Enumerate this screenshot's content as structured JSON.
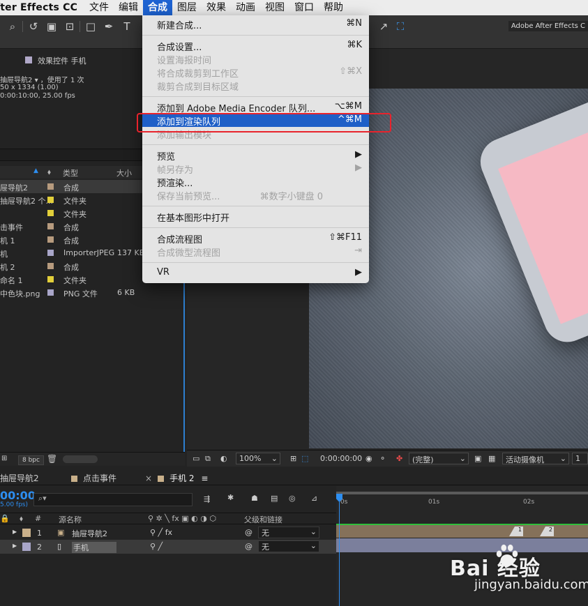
{
  "menubar": {
    "app_name": "fter Effects CC",
    "items": [
      "文件",
      "编辑",
      "合成",
      "图层",
      "效果",
      "动画",
      "视图",
      "窗口",
      "帮助"
    ],
    "active_index": 2
  },
  "toolbar": {
    "app_title": "Adobe After Effects C"
  },
  "effect_controls": {
    "title": "效果控件 手机",
    "comp_name": "抽屉导航2",
    "used": "，使用了 1 次",
    "dims": "50 x 1334 (1.00)",
    "duration": "0:00:10:00, 25.00 fps"
  },
  "project": {
    "col_type": "类型",
    "col_size": "大小",
    "rows": [
      {
        "name": "屉导航2",
        "label_color": "#b79b7e",
        "type": "合成",
        "size": "",
        "selected": true
      },
      {
        "name": "抽屉导航2 个...",
        "label_color": "#e2cf3a",
        "type": "文件夹",
        "size": ""
      },
      {
        "name": "",
        "label_color": "#e2cf3a",
        "type": "文件夹",
        "size": ""
      },
      {
        "name": "击事件",
        "label_color": "#b79b7e",
        "type": "合成",
        "size": ""
      },
      {
        "name": "机 1",
        "label_color": "#b79b7e",
        "type": "合成",
        "size": ""
      },
      {
        "name": "机",
        "label_color": "#a9a6c9",
        "type": "ImporterJPEG",
        "size": "137 KB"
      },
      {
        "name": "机 2",
        "label_color": "#b79b7e",
        "type": "合成",
        "size": ""
      },
      {
        "name": "命名 1",
        "label_color": "#e2cf3a",
        "type": "文件夹",
        "size": ""
      },
      {
        "name": "中色块.png",
        "label_color": "#a9a6c9",
        "type": "PNG 文件",
        "size": "6 KB"
      }
    ],
    "bpc": "8 bpc"
  },
  "viewer": {
    "zoom": "100%",
    "timecode": "0:00:00:00",
    "quality": "(完整)",
    "camera": "活动摄像机",
    "views": "1"
  },
  "timeline": {
    "tabs": [
      {
        "label": "抽屉导航2",
        "color": "#c9b08a"
      },
      {
        "label": "点击事件",
        "color": "#c9b08a"
      },
      {
        "label": "手机 2",
        "color": "#c9b08a",
        "active": true
      }
    ],
    "time": "00:00",
    "fps": "5.00 fps)",
    "search_placeholder": "",
    "col_name": "源名称",
    "col_parent": "父级和链接",
    "ruler": [
      "0s",
      "01s",
      "02s"
    ],
    "layers": [
      {
        "num": "1",
        "name": "抽屉导航2",
        "label_color": "#c9b08a",
        "parent": "无",
        "switch": "fx"
      },
      {
        "num": "2",
        "name": "手机",
        "label_color": "#a9a6c9",
        "parent": "无",
        "switch": ""
      }
    ],
    "markers": [
      "1",
      "2"
    ]
  },
  "compose_menu": {
    "items": [
      {
        "label": "新建合成...",
        "shortcut": "⌘N",
        "disabled": false
      },
      {
        "label": "合成设置...",
        "shortcut": "⌘K",
        "disabled": false
      },
      {
        "label": "设置海报时间",
        "shortcut": "",
        "disabled": true
      },
      {
        "label": "将合成裁剪到工作区",
        "shortcut": "⇧⌘X",
        "disabled": true
      },
      {
        "label": "裁剪合成到目标区域",
        "shortcut": "",
        "disabled": true
      },
      {
        "label": "添加到 Adobe Media Encoder 队列...",
        "shortcut": "⌥⌘M",
        "disabled": false
      },
      {
        "label": "添加到渲染队列",
        "shortcut": "^⌘M",
        "disabled": false,
        "highlighted": true
      },
      {
        "label": "添加输出模块",
        "shortcut": "",
        "disabled": true
      },
      {
        "label": "预览",
        "shortcut": "▶",
        "disabled": false
      },
      {
        "label": "帧另存为",
        "shortcut": "▶",
        "disabled": true
      },
      {
        "label": "预渲染...",
        "shortcut": "",
        "disabled": false
      },
      {
        "label": "保存当前预览...",
        "shortcut": "⌘数字小键盘 0",
        "disabled": true
      },
      {
        "label": "在基本图形中打开",
        "shortcut": "",
        "disabled": false
      },
      {
        "label": "合成流程图",
        "shortcut": "⇧⌘F11",
        "disabled": false
      },
      {
        "label": "合成微型流程图",
        "shortcut": "⇥",
        "disabled": true
      },
      {
        "label": "VR",
        "shortcut": "▶",
        "disabled": false
      }
    ]
  },
  "watermark": {
    "brand": "Bai  经验",
    "url": "jingyan.baidu.com"
  }
}
